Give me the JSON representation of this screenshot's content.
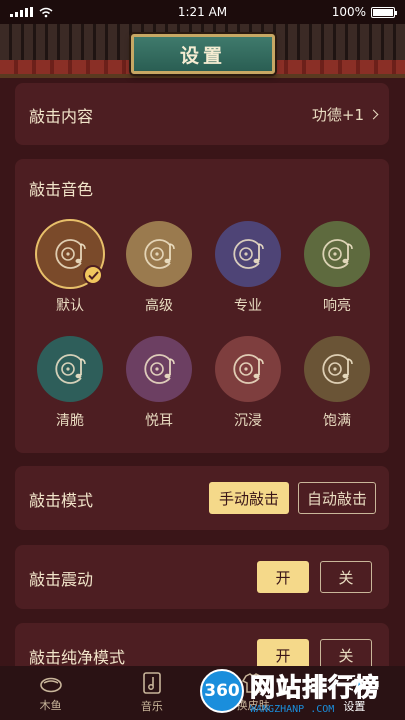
{
  "status_bar": {
    "time": "1:21 AM",
    "battery": "100%"
  },
  "header": {
    "title": "设置"
  },
  "content_row": {
    "label": "敲击内容",
    "value": "功德+1"
  },
  "tone_section": {
    "title": "敲击音色",
    "tones": [
      {
        "name": "默认",
        "color": "#7a4a2a",
        "selected": true
      },
      {
        "name": "高级",
        "color": "#9a7a4e",
        "selected": false
      },
      {
        "name": "专业",
        "color": "#4e4476",
        "selected": false
      },
      {
        "name": "响亮",
        "color": "#5e6a3e",
        "selected": false
      },
      {
        "name": "清脆",
        "color": "#2e5e5a",
        "selected": false
      },
      {
        "name": "悦耳",
        "color": "#6c3f62",
        "selected": false
      },
      {
        "name": "沉浸",
        "color": "#7e3e3e",
        "selected": false
      },
      {
        "name": "饱满",
        "color": "#6a5436",
        "selected": false
      }
    ]
  },
  "mode_row": {
    "label": "敲击模式",
    "option_manual": "手动敲击",
    "option_auto": "自动敲击"
  },
  "vibration_row": {
    "label": "敲击震动",
    "on": "开",
    "off": "关"
  },
  "pure_row": {
    "label": "敲击纯净模式",
    "on": "开",
    "off": "关"
  },
  "bottom_nav": {
    "items": [
      {
        "label": "木鱼",
        "icon": "wooden-fish-icon"
      },
      {
        "label": "音乐",
        "icon": "music-icon"
      },
      {
        "label": "换皮肤",
        "icon": "skin-icon"
      },
      {
        "label": "设置",
        "icon": "settings-icon"
      }
    ],
    "active": "设置"
  },
  "watermark": {
    "badge": "360",
    "main": "网站排行榜",
    "sub": "WANGZHANP    .COM"
  },
  "colors": {
    "background": "#3a1518",
    "card": "#4d1e22",
    "accent": "#f5d98a",
    "plaque": "#2a5e53"
  }
}
